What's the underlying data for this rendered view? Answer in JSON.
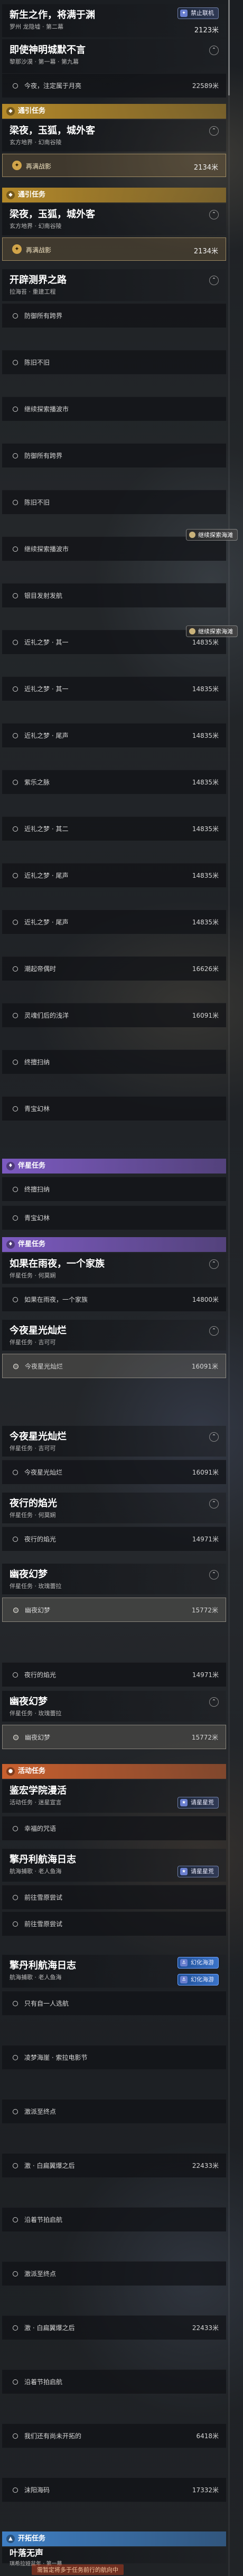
{
  "q1": {
    "title": "新生之作，将满于渊",
    "sub": "罗州 龙隐墟 · 第二幕",
    "tag": "禁止联机",
    "dist": "2123米"
  },
  "q2": {
    "title": "即使神明城默不言",
    "sub": "黎那沙漠 · 第一幕 · 第九幕",
    "row": "今夜，注定属于月亮",
    "row_dist": "22589米"
  },
  "cat_gold_1": "通引任务",
  "q3": {
    "title": "梁夜，玉狐，城外客",
    "sub": "玄方地界 · 幻南谷陵",
    "reward": "再满战影",
    "reward_dist": "2134米"
  },
  "cat_gold_2": "通引任务",
  "q4": {
    "title": "梁夜，玉狐，城外客",
    "sub": "玄方地界 · 幻南谷陵",
    "reward": "再满战影",
    "reward_dist": "2134米"
  },
  "q5": {
    "title": "开辟测界之路",
    "sub": "拉海苔 · 重建工程"
  },
  "list_a": [
    {
      "label": "防御所有跨界"
    },
    {
      "label": "陈旧不旧"
    },
    {
      "label": "继续探索播波市"
    },
    {
      "label": "防御所有跨界"
    },
    {
      "label": "陈旧不旧"
    },
    {
      "label": "继续探索播波市"
    },
    {
      "label": "银目发射发航"
    },
    {
      "label": "近礼之梦 · 其一",
      "dist": "14835米"
    },
    {
      "label": "近礼之梦 · 其一",
      "dist": "14835米"
    },
    {
      "label": "近礼之梦 · 尾声",
      "dist": "14835米"
    },
    {
      "label": "紫乐之脉",
      "dist": "14835米"
    },
    {
      "label": "近礼之梦 · 其二",
      "dist": "14835米"
    },
    {
      "label": "近礼之梦 · 尾声",
      "dist": "14835米"
    },
    {
      "label": "近礼之梦 · 尾声",
      "dist": "14835米"
    },
    {
      "label": "潮起帝偶时",
      "dist": "16626米"
    },
    {
      "label": "灵魂们后的浅洋",
      "dist": "16091米"
    },
    {
      "label": "终擅扫纳"
    },
    {
      "label": "青宝幻林"
    }
  ],
  "track_tag_1": "继续探索海滩",
  "track_tag_2": "继续探索海滩",
  "cat_purple_1": "伴星任务",
  "list_b": [
    {
      "label": "终擅扫纳"
    },
    {
      "label": "青宝幻林"
    }
  ],
  "cat_purple_2": "伴星任务",
  "q6": {
    "title": "如果在雨夜，一个家族",
    "sub": "伴星任务 · 何莫娴",
    "row": "如果在雨夜，一个家族",
    "row_dist": "14800米"
  },
  "q7": {
    "title": "今夜星光灿烂",
    "sub": "伴星任务 · 吉可可",
    "row": "今夜星光灿烂",
    "row_dist": "16091米"
  },
  "q8": {
    "title": "今夜星光灿烂",
    "sub": "伴星任务 · 吉可可",
    "row": "今夜星光灿烂",
    "row_dist": "16091米"
  },
  "q9": {
    "title": "夜行的焰光",
    "sub": "伴星任务 · 何莫娴",
    "row": "夜行的焰光",
    "row_dist": "14971米"
  },
  "q10": {
    "title": "幽夜幻梦",
    "sub": "伴星任务 · 玫瑰蕾拉",
    "row": "幽夜幻梦",
    "row_dist": "15772米"
  },
  "q11": {
    "row": "夜行的焰光",
    "row_dist": "14971米",
    "title": "幽夜幻梦",
    "sub": "伴星任务 · 玫瑰蕾拉",
    "row2": "幽夜幻梦",
    "row2_dist": "15772米"
  },
  "cat_orange": "活动任务",
  "q12": {
    "title": "鉴宏学院漫活",
    "sub": "活动任务 · 迷星宣言",
    "tag": "请星星荒",
    "row": "幸福的咒语"
  },
  "q13": {
    "title": "擎丹利航海日志",
    "sub": "航海捕歌 · 老人鱼海",
    "tag": "请星星荒",
    "rows": [
      "前往雪原尝试",
      "前往雪原尝试"
    ]
  },
  "q14": {
    "title": "擎丹利航海日志",
    "sub": "航海捕歌 · 老人鱼海",
    "tag": "幻化海游",
    "tag2": "幻化海游",
    "rows": [
      {
        "label": "只有自一人选航"
      },
      {
        "label": "凌梦海崖 · 索拉电影节"
      },
      {
        "label": "激派至终点"
      },
      {
        "label": "激 · 白扁翼爆之后",
        "dist": "22433米"
      },
      {
        "label": "沿着节拍启航"
      },
      {
        "label": "激派至终点"
      },
      {
        "label": "激 · 白扁翼爆之后",
        "dist": "22433米"
      },
      {
        "label": "沿着节拍启航"
      },
      {
        "label": "我们还有尚未开拓的",
        "dist": "6418米"
      },
      {
        "label": "沫阳海码",
        "dist": "17332米"
      }
    ]
  },
  "cat_blue": "开拓任务",
  "q15": {
    "title": "叶落无声",
    "sub": "琪希拉娅盆年 · 第一幕"
  },
  "bottom_note": "需暂定将多于任务前行的航向中"
}
